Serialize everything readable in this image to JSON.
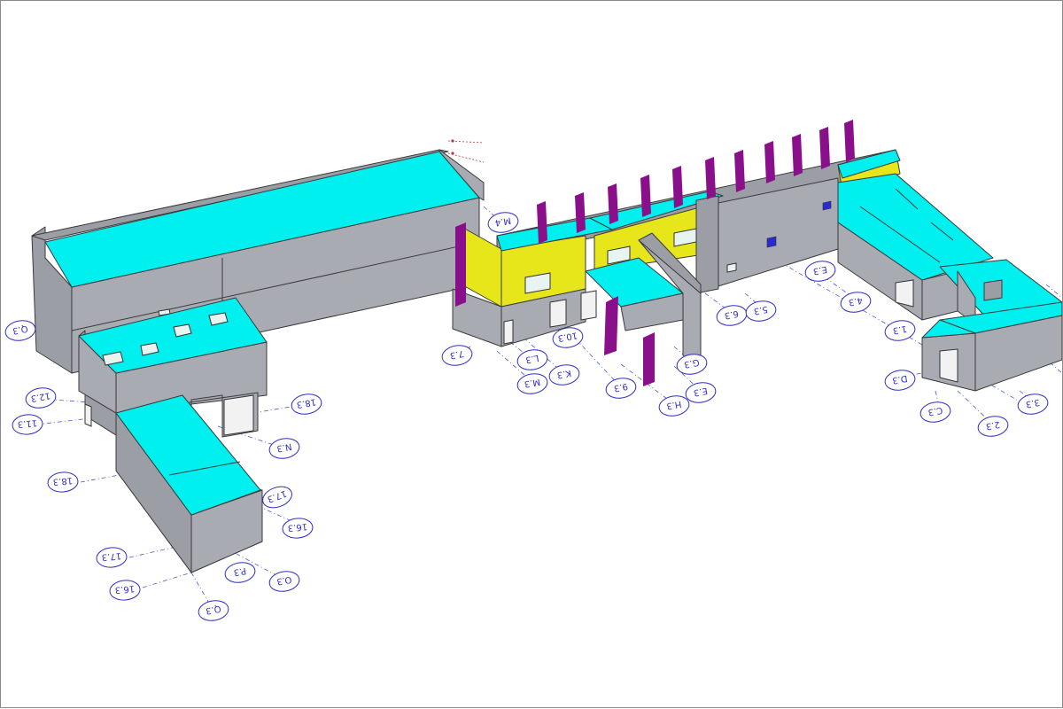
{
  "model": {
    "background": "#ffffff",
    "colors": {
      "wall": "#a9abb3",
      "roof": "#00f0f0",
      "accent_panel": "#e6e61a",
      "column": "#8a0f8a",
      "grid": "#4a5bd8"
    },
    "grid_bubbles": [
      {
        "label": "Q.3"
      },
      {
        "label": "12.3"
      },
      {
        "label": "11.3"
      },
      {
        "label": "18.3"
      },
      {
        "label": "17.3"
      },
      {
        "label": "16.3"
      },
      {
        "label": "Q.3"
      },
      {
        "label": "P.3"
      },
      {
        "label": "O.3"
      },
      {
        "label": "16.3"
      },
      {
        "label": "17.3"
      },
      {
        "label": "N.3"
      },
      {
        "label": "18.3"
      },
      {
        "label": "M.4"
      },
      {
        "label": "7.3"
      },
      {
        "label": "M.3"
      },
      {
        "label": "L.3"
      },
      {
        "label": "K.3"
      },
      {
        "label": "10.3"
      },
      {
        "label": "9.3"
      },
      {
        "label": "E.3"
      },
      {
        "label": "H.3"
      },
      {
        "label": "G.3"
      },
      {
        "label": "6.3"
      },
      {
        "label": "5.3"
      },
      {
        "label": "E.3"
      },
      {
        "label": "4.3"
      },
      {
        "label": "1.3"
      },
      {
        "label": "D.3"
      },
      {
        "label": "C.3"
      },
      {
        "label": "2.3"
      },
      {
        "label": "3.3"
      }
    ]
  }
}
